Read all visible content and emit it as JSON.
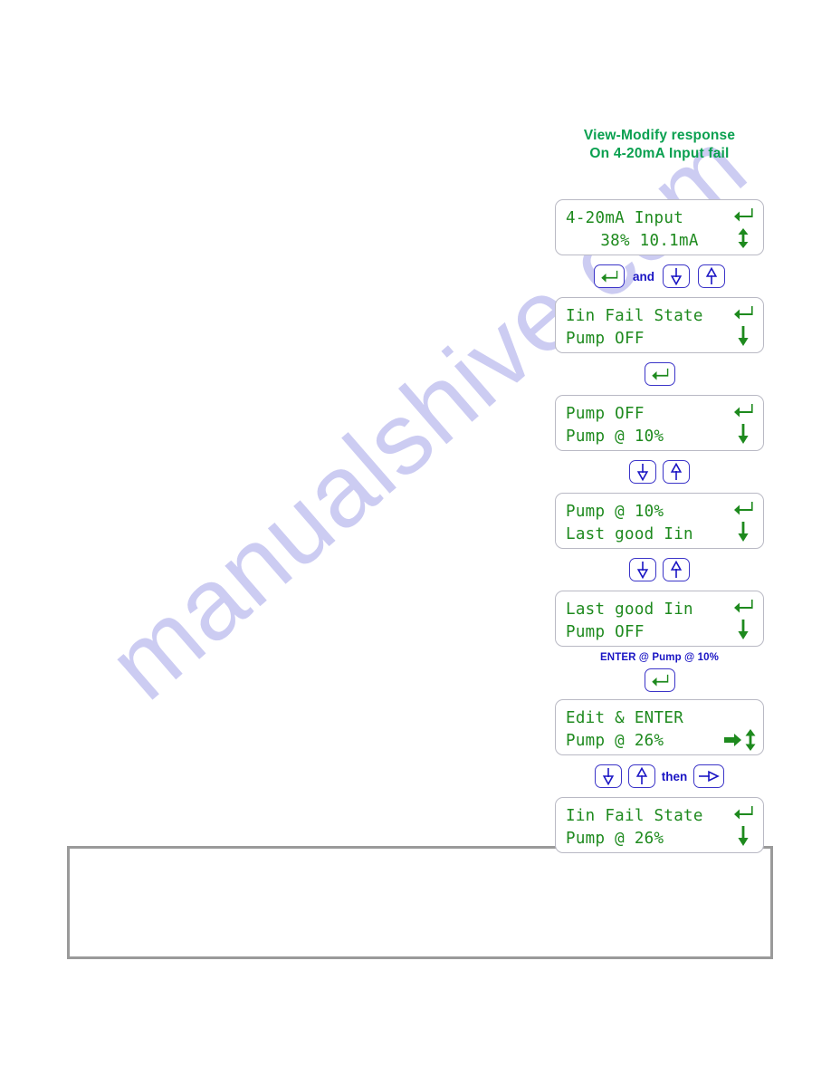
{
  "watermark": {
    "text": "manualshive.com"
  },
  "colors": {
    "lcd_green": "#1e8a1e",
    "title_green": "#0aa050",
    "key_blue": "#3b34c8",
    "label_blue": "#1a15c4",
    "lcd_border": "#b9b9c4",
    "bottom_box_border": "#9a9a9a"
  },
  "title": {
    "line1": "View-Modify response",
    "line2": "On 4-20mA Input fail"
  },
  "steps": [
    {
      "id": "screen-4-20ma-input",
      "line1": "4-20mA Input",
      "line2": "38% 10.1mA",
      "line2_centered": true,
      "icons": [
        "enter-arrow-icon",
        "up-down-arrow-icon"
      ]
    },
    {
      "id": "keys-enter-and-updown",
      "keys": [
        "enter-key",
        "and",
        "down-key",
        "up-key"
      ],
      "connector_label": "and"
    },
    {
      "id": "screen-iin-fail-state-pump-off",
      "line1": "Iin Fail State",
      "line2": "Pump OFF",
      "icons": [
        "enter-arrow-icon",
        "down-arrow-icon"
      ]
    },
    {
      "id": "keys-enter-1",
      "keys": [
        "enter-key"
      ]
    },
    {
      "id": "screen-pump-off-pump-10",
      "line1": "Pump OFF",
      "line2": "Pump @ 10%",
      "icons": [
        "enter-arrow-icon",
        "down-arrow-icon"
      ]
    },
    {
      "id": "keys-down-up-1",
      "keys": [
        "down-key",
        "up-key"
      ]
    },
    {
      "id": "screen-pump-10-last-good-iin",
      "line1": "Pump @ 10%",
      "line2": "Last good Iin",
      "icons": [
        "enter-arrow-icon",
        "down-arrow-icon"
      ]
    },
    {
      "id": "keys-down-up-2",
      "keys": [
        "down-key",
        "up-key"
      ]
    },
    {
      "id": "screen-last-good-iin-pump-off",
      "line1": "Last good Iin",
      "line2": "Pump OFF",
      "icons": [
        "enter-arrow-icon",
        "down-arrow-icon"
      ]
    },
    {
      "id": "annotation-enter-at-pump-10",
      "annotation": "ENTER @ Pump @ 10%"
    },
    {
      "id": "keys-enter-2",
      "keys": [
        "enter-key"
      ]
    },
    {
      "id": "screen-edit-and-enter",
      "line1": "Edit & ENTER",
      "line2": "Pump @ 26%",
      "icons": [
        "right-arrow-icon",
        "up-down-arrow-icon"
      ]
    },
    {
      "id": "keys-down-up-then-right",
      "keys": [
        "down-key",
        "up-key",
        "then",
        "right-key"
      ],
      "connector_label": "then"
    },
    {
      "id": "screen-iin-fail-state-pump-26",
      "line1": "Iin Fail State",
      "line2": "Pump @ 26%",
      "icons": [
        "enter-arrow-icon",
        "down-arrow-icon"
      ]
    }
  ]
}
